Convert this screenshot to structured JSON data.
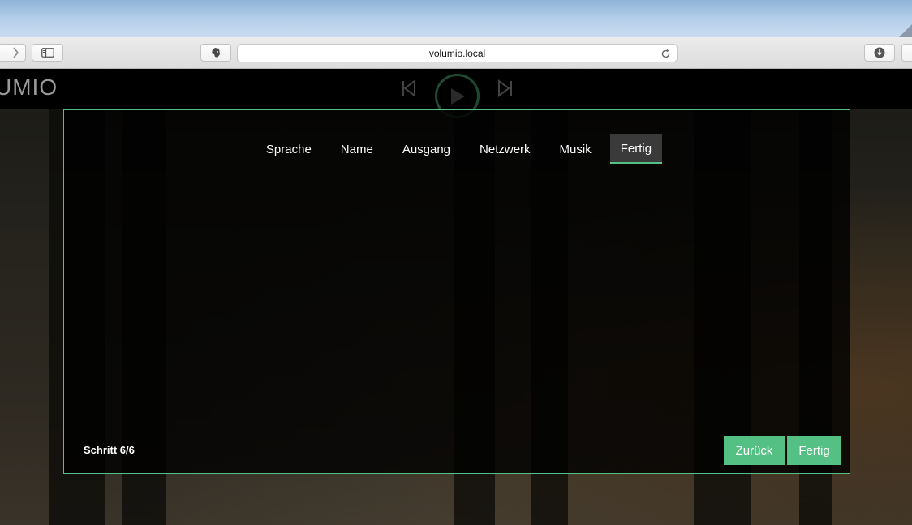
{
  "browser": {
    "url": "volumio.local",
    "icons": {
      "back": "chevron-left-icon",
      "forward": "chevron-right-icon",
      "sidebar": "sidebar-icon",
      "extension": "evernote-icon",
      "reload": "reload-icon",
      "downloads": "download-icon"
    }
  },
  "app": {
    "logo_text": "UMIO",
    "player": {
      "icons": {
        "prev": "skip-back-icon",
        "play": "play-icon",
        "next": "skip-forward-icon"
      }
    }
  },
  "wizard": {
    "steps": [
      {
        "label": "Sprache",
        "active": false
      },
      {
        "label": "Name",
        "active": false
      },
      {
        "label": "Ausgang",
        "active": false
      },
      {
        "label": "Netzwerk",
        "active": false
      },
      {
        "label": "Musik",
        "active": false
      },
      {
        "label": "Fertig",
        "active": true
      }
    ],
    "step_counter": "Schritt 6/6",
    "buttons": {
      "back_label": "Zurück",
      "finish_label": "Fertig"
    }
  },
  "colors": {
    "accent": "#54c083"
  }
}
